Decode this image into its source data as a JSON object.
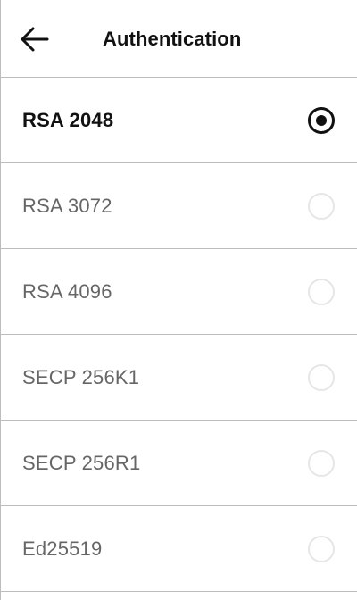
{
  "header": {
    "title": "Authentication",
    "back_icon": "arrow-left-icon"
  },
  "options": [
    {
      "label": "RSA 2048",
      "selected": true
    },
    {
      "label": "RSA 3072",
      "selected": false
    },
    {
      "label": "RSA 4096",
      "selected": false
    },
    {
      "label": "SECP 256K1",
      "selected": false
    },
    {
      "label": "SECP 256R1",
      "selected": false
    },
    {
      "label": "Ed25519",
      "selected": false
    }
  ],
  "colors": {
    "selected_text": "#111111",
    "unselected_text": "#666666",
    "divider": "#bdbdbd",
    "radio_border": "#e6e6e6"
  }
}
